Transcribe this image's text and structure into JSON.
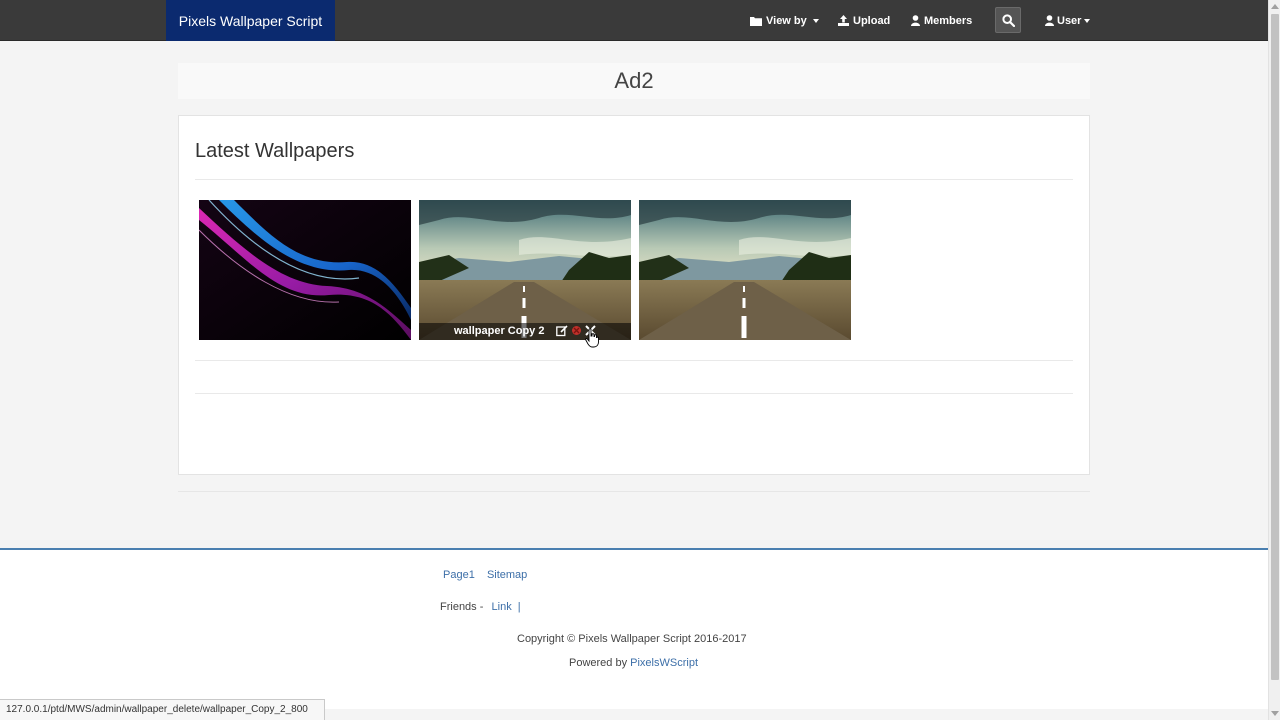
{
  "navbar": {
    "brand": "Pixels Wallpaper Script",
    "view_by": "View by",
    "upload": "Upload",
    "members": "Members",
    "user": "User",
    "bg_color": "#3a3a3a",
    "brand_color": "#0b2a6f"
  },
  "ad": {
    "label": "Ad2"
  },
  "latest": {
    "title": "Latest Wallpapers",
    "wallpapers": [
      {
        "name": "abstract-light-swirl",
        "caption": ""
      },
      {
        "name": "road-landscape",
        "caption": "wallpaper Copy 2"
      },
      {
        "name": "road-landscape",
        "caption": ""
      }
    ]
  },
  "footer": {
    "page1": "Page1",
    "sitemap": "Sitemap",
    "friends_label": "Friends -",
    "friends_link": "Link",
    "friends_sep": "|",
    "copyright": "Copyright © Pixels Wallpaper Script 2016-2017",
    "powered_label": "Powered by",
    "powered_link": "PixelsWScript",
    "accent_color": "#4a7fb0"
  },
  "statusbar": {
    "url": "127.0.0.1/ptd/MWS/admin/wallpaper_delete/wallpaper_Copy_2_800"
  }
}
